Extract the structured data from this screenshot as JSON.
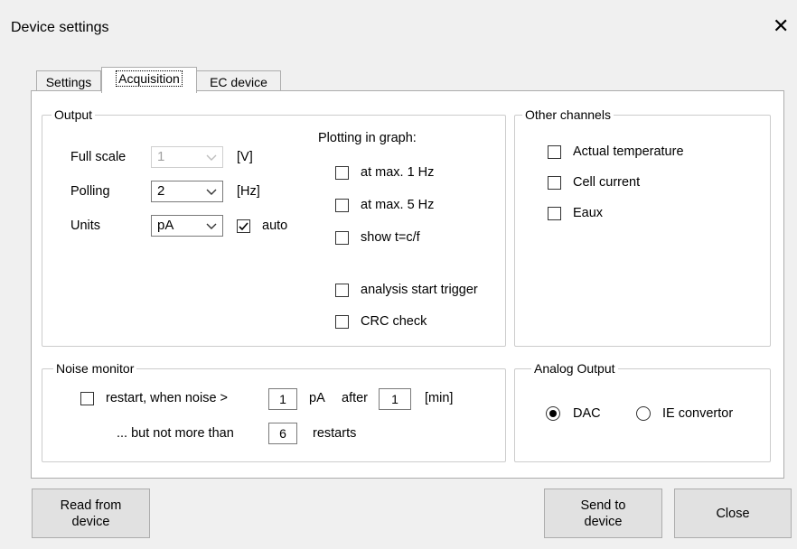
{
  "window": {
    "title": "Device settings",
    "close_glyph": "✕"
  },
  "tabs": [
    {
      "label": "Settings"
    },
    {
      "label": "Acquisition",
      "active": true
    },
    {
      "label": "EC device"
    }
  ],
  "output": {
    "legend": "Output",
    "full_scale": {
      "label": "Full scale",
      "value": "1",
      "unit": "[V]"
    },
    "polling": {
      "label": "Polling",
      "value": "2",
      "unit": "[Hz]"
    },
    "units": {
      "label": "Units",
      "value": "pA",
      "auto_label": "auto",
      "auto_checked": true
    },
    "plotting": {
      "title": "Plotting in graph:",
      "max1": "at max. 1 Hz",
      "max5": "at max. 5 Hz",
      "show_tcf": "show t=c/f",
      "analysis_trigger": "analysis start trigger",
      "crc_check": "CRC check"
    }
  },
  "other_channels": {
    "legend": "Other channels",
    "actual_temperature": "Actual temperature",
    "cell_current": "Cell current",
    "eaux": "Eaux"
  },
  "noise_monitor": {
    "legend": "Noise monitor",
    "restart_label": "restart, when noise >",
    "noise_value": "1",
    "noise_unit": "pA",
    "after_label": "after",
    "after_value": "1",
    "after_unit": "[min]",
    "but_label": "... but not more than",
    "restarts_value": "6",
    "restarts_label": "restarts"
  },
  "analog_output": {
    "legend": "Analog Output",
    "dac": "DAC",
    "ie": "IE convertor",
    "selected": "DAC"
  },
  "buttons": {
    "read": "Read from device",
    "send": "Send to device",
    "close": "Close"
  },
  "icons": {
    "chevron": "chevron-down-icon",
    "check": "check-icon"
  }
}
